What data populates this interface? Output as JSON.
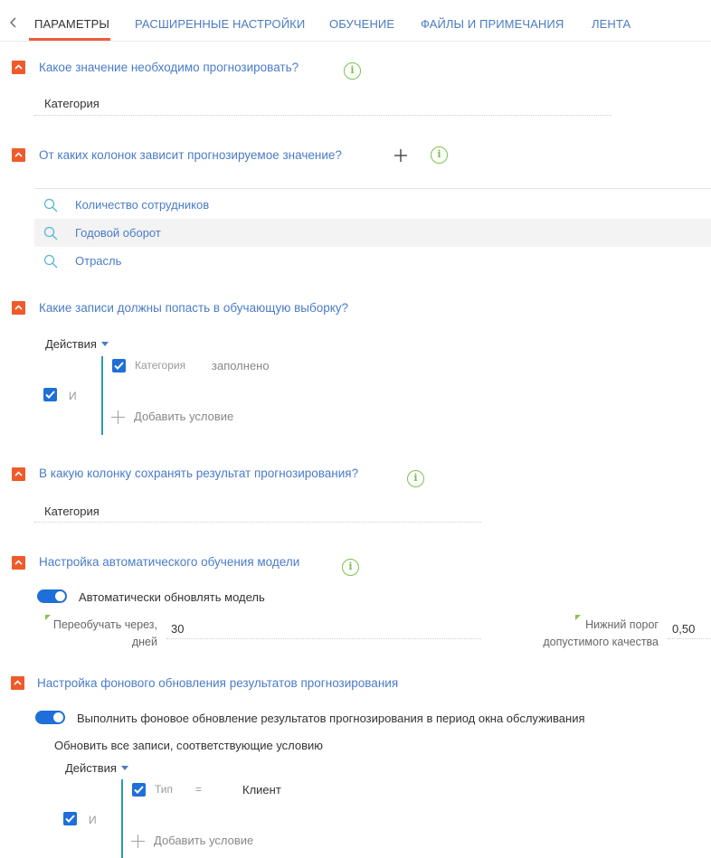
{
  "tabs": {
    "items": [
      "ПАРАМЕТРЫ",
      "РАСШИРЕННЫЕ НАСТРОЙКИ",
      "ОБУЧЕНИЕ",
      "ФАЙЛЫ И ПРИМЕЧАНИЯ",
      "ЛЕНТА"
    ],
    "active": "ПАРАМЕТРЫ"
  },
  "section_predict_value": {
    "title": "Какое значение необходимо прогнозировать?",
    "value": "Категория"
  },
  "section_columns": {
    "title": "От каких колонок зависит прогнозируемое значение?",
    "items": [
      "Количество сотрудников",
      "Годовой оборот",
      "Отрасль"
    ]
  },
  "section_training_sample": {
    "title": "Какие записи должны попасть в обучающую выборку?",
    "actions_label": "Действия",
    "group_operator": "И",
    "condition_field": "Категория",
    "condition_value": "заполнено",
    "add_condition_label": "Добавить условие"
  },
  "section_result_column": {
    "title": "В какую колонку сохранять результат прогнозирования?",
    "value": "Категория"
  },
  "section_auto_training": {
    "title": "Настройка автоматического обучения модели",
    "toggle_label": "Автоматически обновлять модель",
    "toggle_on": true,
    "retrain_label_line1": "Переобучать через,",
    "retrain_label_line2": "дней",
    "retrain_value": "30",
    "threshold_label_line1": "Нижний порог",
    "threshold_label_line2": "допустимого качества",
    "threshold_value": "0,50"
  },
  "section_background_update": {
    "title": "Настройка фонового обновления результатов прогнозирования",
    "toggle_label": "Выполнить фоновое обновление результатов прогнозирования в период окна обслуживания",
    "toggle_on": true,
    "subtitle": "Обновить все записи, соответствующие условию",
    "actions_label": "Действия",
    "group_operator": "И",
    "condition_field": "Тип",
    "condition_operator": "=",
    "condition_value": "Клиент",
    "add_condition_label": "Добавить условие"
  },
  "colors": {
    "accent_blue": "#4a7bc8",
    "collapse_orange": "#f05a2a",
    "checkbox_blue": "#1e6fd9",
    "info_green": "#7cc04b",
    "tab_underline": "#ee5b3b"
  }
}
